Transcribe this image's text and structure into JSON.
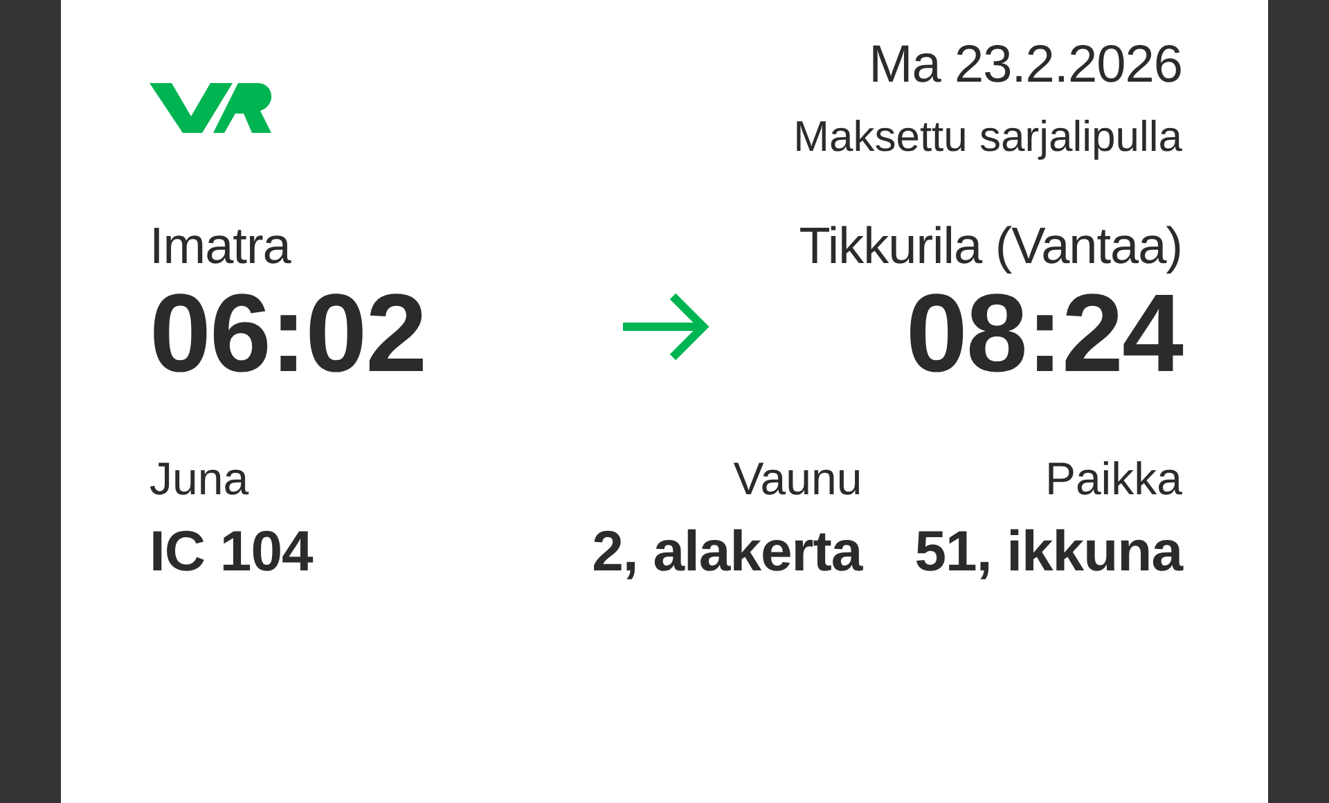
{
  "ticket": {
    "date": "Ma 23.2.2026",
    "payment": "Maksettu sarjalipulla",
    "departure": {
      "station": "Imatra",
      "time": "06:02"
    },
    "arrival": {
      "station": "Tikkurila (Vantaa)",
      "time": "08:24"
    },
    "details": [
      {
        "label": "Juna",
        "value": "IC 104"
      },
      {
        "label": "Vaunu",
        "value": "2, alakerta"
      },
      {
        "label": "Paikka",
        "value": "51, ikkuna"
      }
    ]
  }
}
